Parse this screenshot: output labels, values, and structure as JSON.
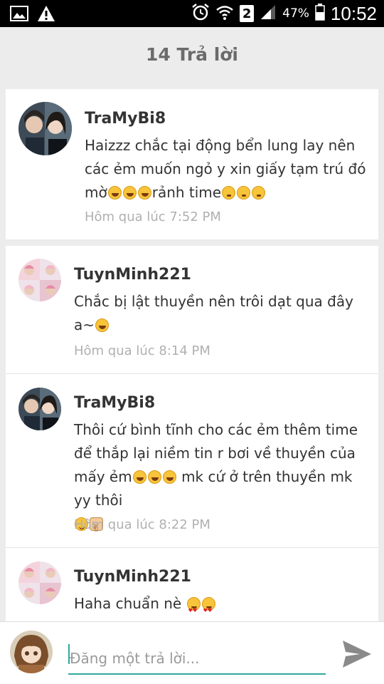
{
  "status_bar": {
    "icons": [
      "image-icon",
      "warning-icon",
      "alarm-icon",
      "wifi-icon",
      "signal-icon",
      "battery-icon"
    ],
    "sim_slot": "2",
    "battery_percent": "47%",
    "time": "10:52"
  },
  "header": {
    "title": "14 Trả lời"
  },
  "original_post": {
    "username": "TraMyBi8",
    "text": "Haizzz chắc tại động bển lung lay nên các ẻm muốn ngỏ y xin giấy tạm trú đó mờ",
    "text_after_emoji": "rảnh time",
    "timestamp": "Hôm qua lúc 7:52 PM"
  },
  "replies": [
    {
      "username": "TuynMinh221",
      "text": "Chắc bị lật thuyền nên trôi dạt qua đây a~",
      "timestamp": "Hôm qua lúc 8:14 PM"
    },
    {
      "username": "TraMyBi8",
      "text": "Thôi cứ bình tĩnh cho các ẻm thêm time để thắp lại niềm tin r bơi về thuyền của mấy ẻm",
      "text_after_emoji": " mk cứ ở trên thuyền mk yy thôi",
      "timestamp": "Hôm qua lúc 8:22 PM"
    },
    {
      "username": "TuynMinh221",
      "text": "Haha chuẩn nè ",
      "timestamp": ""
    }
  ],
  "composer": {
    "placeholder": "Đăng một trả lời..."
  },
  "colors": {
    "accent": "#2fa8a0",
    "header_text": "#6b6b6b",
    "timestamp": "#b0b0b0",
    "background": "#ececec"
  }
}
